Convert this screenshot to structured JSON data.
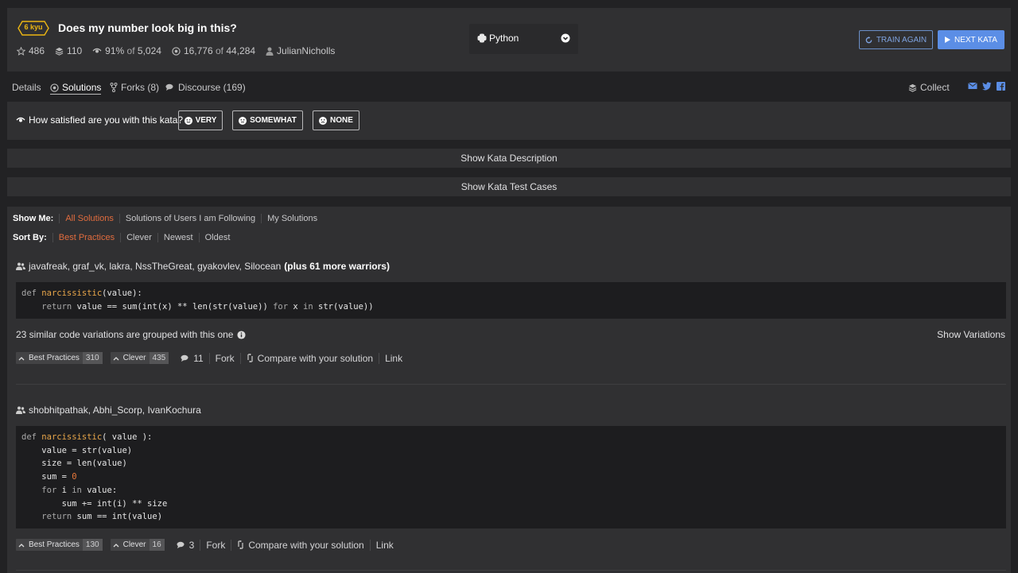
{
  "kata": {
    "rank": "6 kyu",
    "title": "Does my number look big in this?",
    "stars": "486",
    "collections": "110",
    "satisfaction_pct": "91%",
    "satisfaction_of": "of",
    "satisfaction_votes": "5,024",
    "completed": "16,776",
    "completed_of": "of",
    "attempted": "44,284",
    "author": "JulianNicholls"
  },
  "language": {
    "selected": "Python"
  },
  "buttons": {
    "train_again": "TRAIN AGAIN",
    "next_kata": "NEXT KATA"
  },
  "tabs": [
    {
      "label": "Details"
    },
    {
      "label": "Solutions"
    },
    {
      "label": "Forks (8)"
    },
    {
      "label": "Discourse (169)"
    }
  ],
  "collect_label": "Collect",
  "satisfaction": {
    "question": "How satisfied are you with this kata?",
    "options": [
      "VERY",
      "SOMEWHAT",
      "NONE"
    ]
  },
  "show_description": "Show Kata Description",
  "show_test_cases": "Show Kata Test Cases",
  "filters": {
    "show_me_label": "Show Me:",
    "show_me": [
      "All Solutions",
      "Solutions of Users I am Following",
      "My Solutions"
    ],
    "sort_by_label": "Sort By:",
    "sort_by": [
      "Best Practices",
      "Clever",
      "Newest",
      "Oldest"
    ]
  },
  "solutions": [
    {
      "authors": "javafreak, graf_vk, lakra, NssTheGreat, gyakovlev, Silocean",
      "more": "(plus 61 more warriors)",
      "variations_text": "23 similar code variations are grouped with this one",
      "show_variations": "Show Variations",
      "best_practices_label": "Best Practices",
      "best_practices": "310",
      "clever_label": "Clever",
      "clever": "435",
      "comments": "11",
      "fork": "Fork",
      "compare": "Compare with your solution",
      "link": "Link"
    },
    {
      "authors": "shobhitpathak, Abhi_Scorp, IvanKochura",
      "best_practices_label": "Best Practices",
      "best_practices": "130",
      "clever_label": "Clever",
      "clever": "16",
      "comments": "3",
      "fork": "Fork",
      "compare": "Compare with your solution",
      "link": "Link"
    }
  ],
  "code": {
    "s1": {
      "l1_kw": "def",
      "l1_fn": "narcissistic",
      "l1_rest": "(value):",
      "l2_kw": "return",
      "l2_a": " value == sum(int(x) ** len(str(value)) ",
      "l2_kw2": "for",
      "l2_b": " x ",
      "l2_kw3": "in",
      "l2_c": " str(value))"
    },
    "s2": {
      "l1_kw": "def",
      "l1_fn": "narcissistic",
      "l1_rest": "( value ):",
      "l2": "value = str(value)",
      "l3": "size = len(value)",
      "l4_a": "sum = ",
      "l4_num": "0",
      "l5_kw": "for",
      "l5_b": " i ",
      "l5_kw2": "in",
      "l5_c": " value:",
      "l6": "sum += int(i) ** size",
      "l7_kw": "return",
      "l7_b": " sum == int(value)"
    }
  },
  "colors": {
    "accent": "#e16c3e",
    "rank": "#ecb613",
    "primary": "#5b8ee6",
    "bg": "#222224",
    "panel": "#303032"
  }
}
